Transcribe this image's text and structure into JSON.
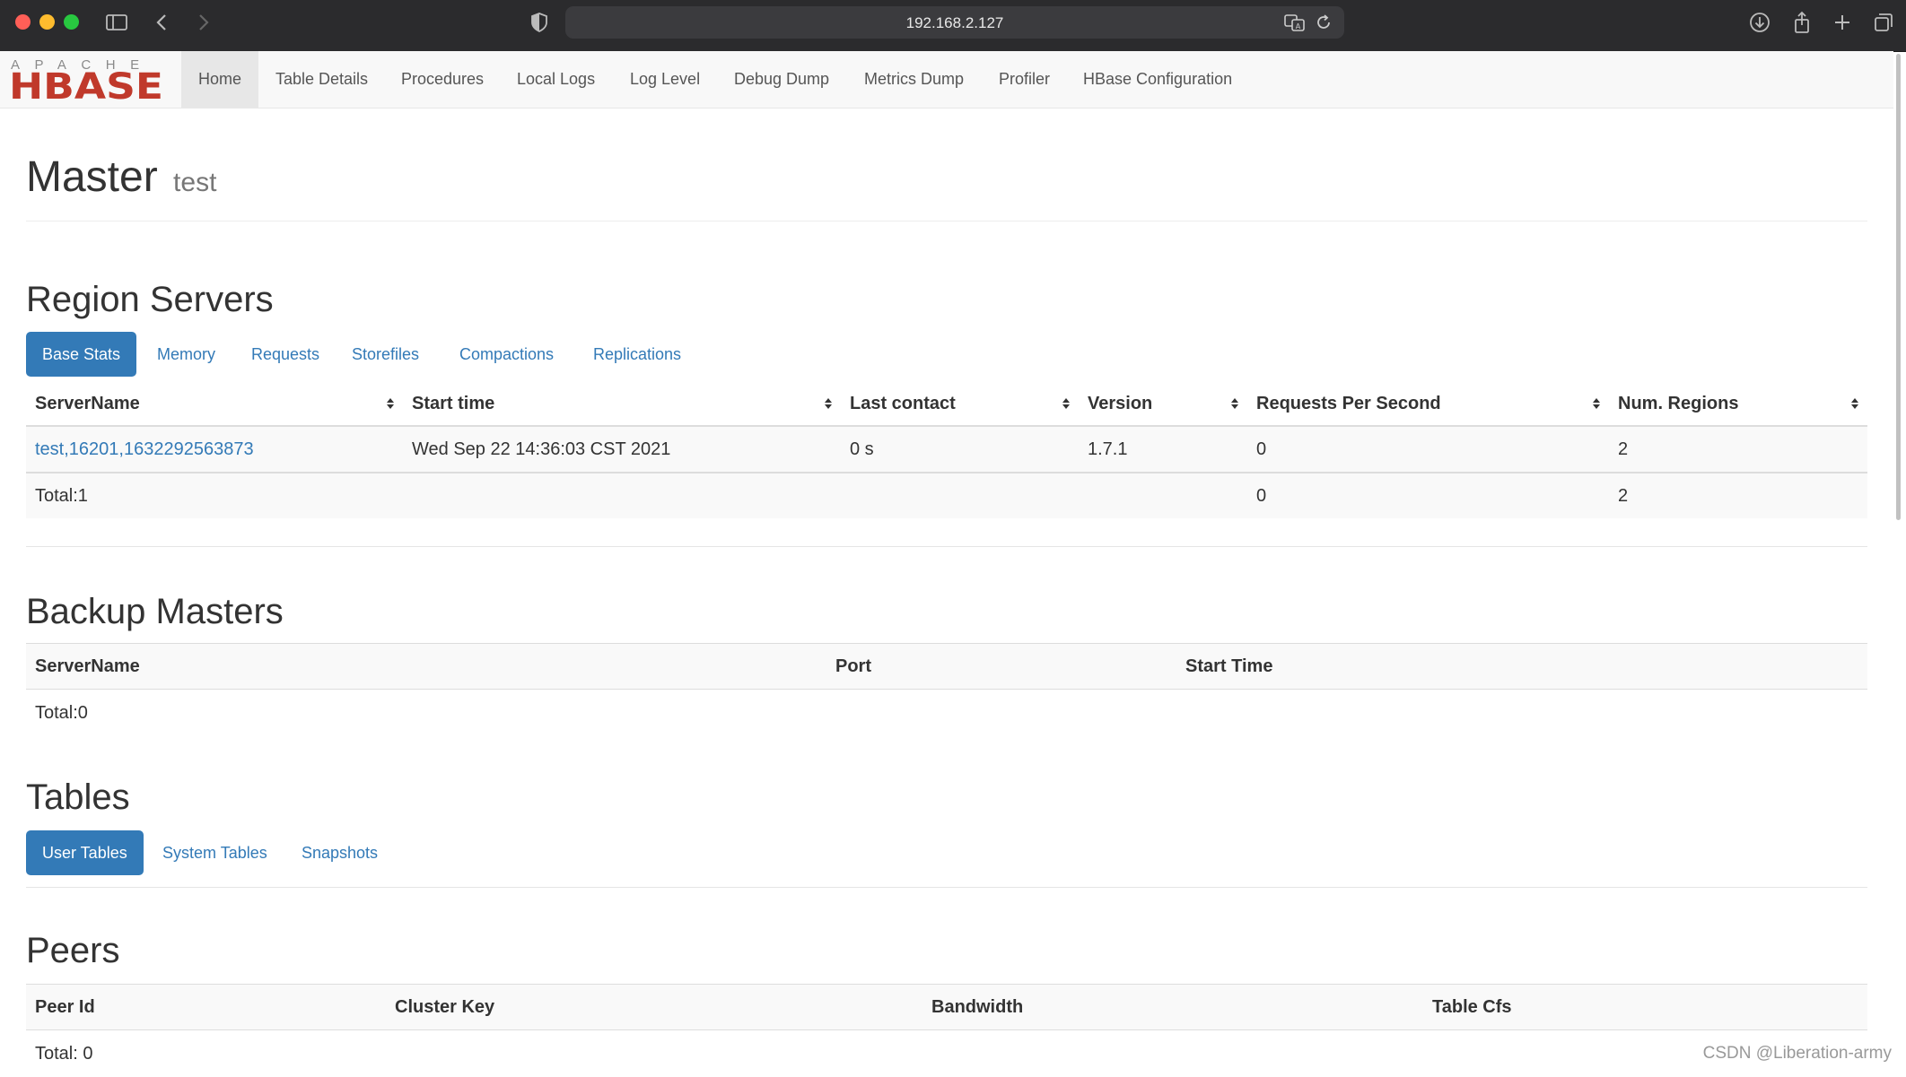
{
  "browser": {
    "url": "192.168.2.127"
  },
  "nav": {
    "items": [
      {
        "label": "Home",
        "active": true
      },
      {
        "label": "Table Details"
      },
      {
        "label": "Procedures"
      },
      {
        "label": "Local Logs"
      },
      {
        "label": "Log Level"
      },
      {
        "label": "Debug Dump"
      },
      {
        "label": "Metrics Dump"
      },
      {
        "label": "Profiler"
      },
      {
        "label": "HBase Configuration"
      }
    ],
    "logo_top": "APACHE",
    "logo_bottom": "HBASE"
  },
  "header": {
    "title": "Master",
    "subtitle": "test"
  },
  "region_servers": {
    "title": "Region Servers",
    "tabs": [
      "Base Stats",
      "Memory",
      "Requests",
      "Storefiles",
      "Compactions",
      "Replications"
    ],
    "active_tab": "Base Stats",
    "columns": [
      "ServerName",
      "Start time",
      "Last contact",
      "Version",
      "Requests Per Second",
      "Num. Regions"
    ],
    "rows": [
      {
        "server_name": "test,16201,1632292563873",
        "start_time": "Wed Sep 22 14:36:03 CST 2021",
        "last_contact": "0 s",
        "version": "1.7.1",
        "requests_per_second": "0",
        "num_regions": "2"
      }
    ],
    "total": {
      "label": "Total:1",
      "requests_per_second": "0",
      "num_regions": "2"
    }
  },
  "backup_masters": {
    "title": "Backup Masters",
    "columns": [
      "ServerName",
      "Port",
      "Start Time"
    ],
    "total": "Total:0"
  },
  "tables": {
    "title": "Tables",
    "tabs": [
      "User Tables",
      "System Tables",
      "Snapshots"
    ],
    "active_tab": "User Tables"
  },
  "peers": {
    "title": "Peers",
    "columns": [
      "Peer Id",
      "Cluster Key",
      "Bandwidth",
      "Table Cfs"
    ],
    "total": "Total: 0"
  },
  "watermark": "CSDN @Liberation-army",
  "colors": {
    "primary": "#337ab7",
    "logo_red": "#c0392b",
    "navbar_bg": "#f8f8f8",
    "chrome_bg": "#2b2b2d"
  }
}
